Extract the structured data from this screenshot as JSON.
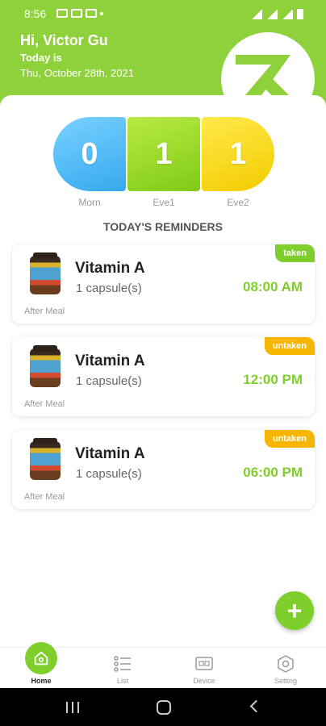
{
  "status_bar": {
    "time": "8:56"
  },
  "header": {
    "greeting": "Hi, Victor Gu",
    "today_label": "Today is",
    "date": "Thu, October 28th, 2021"
  },
  "slots": [
    {
      "count": "0",
      "label": "Morn",
      "color": "#4bb8f5"
    },
    {
      "count": "1",
      "label": "Eve1",
      "color": "#8fd13a"
    },
    {
      "count": "1",
      "label": "Eve2",
      "color": "#f7d20a"
    }
  ],
  "section_title": "TODAY'S REMINDERS",
  "reminders": [
    {
      "name": "Vitamin A",
      "dose": "1 capsule(s)",
      "time": "08:00 AM",
      "note": "After Meal",
      "status": "taken"
    },
    {
      "name": "Vitamin A",
      "dose": "1 capsule(s)",
      "time": "12:00 PM",
      "note": "After Meal",
      "status": "untaken"
    },
    {
      "name": "Vitamin A",
      "dose": "1 capsule(s)",
      "time": "06:00 PM",
      "note": "After Meal",
      "status": "untaken"
    }
  ],
  "fab_label": "+",
  "nav": {
    "items": [
      {
        "label": "Home",
        "icon": "home-icon",
        "active": true
      },
      {
        "label": "List",
        "icon": "list-icon",
        "active": false
      },
      {
        "label": "Device",
        "icon": "device-icon",
        "active": false
      },
      {
        "label": "Setting",
        "icon": "settings-icon",
        "active": false
      }
    ]
  },
  "colors": {
    "brand": "#8fd13a",
    "accent_green": "#7fcf2c",
    "untaken": "#f7b500"
  }
}
